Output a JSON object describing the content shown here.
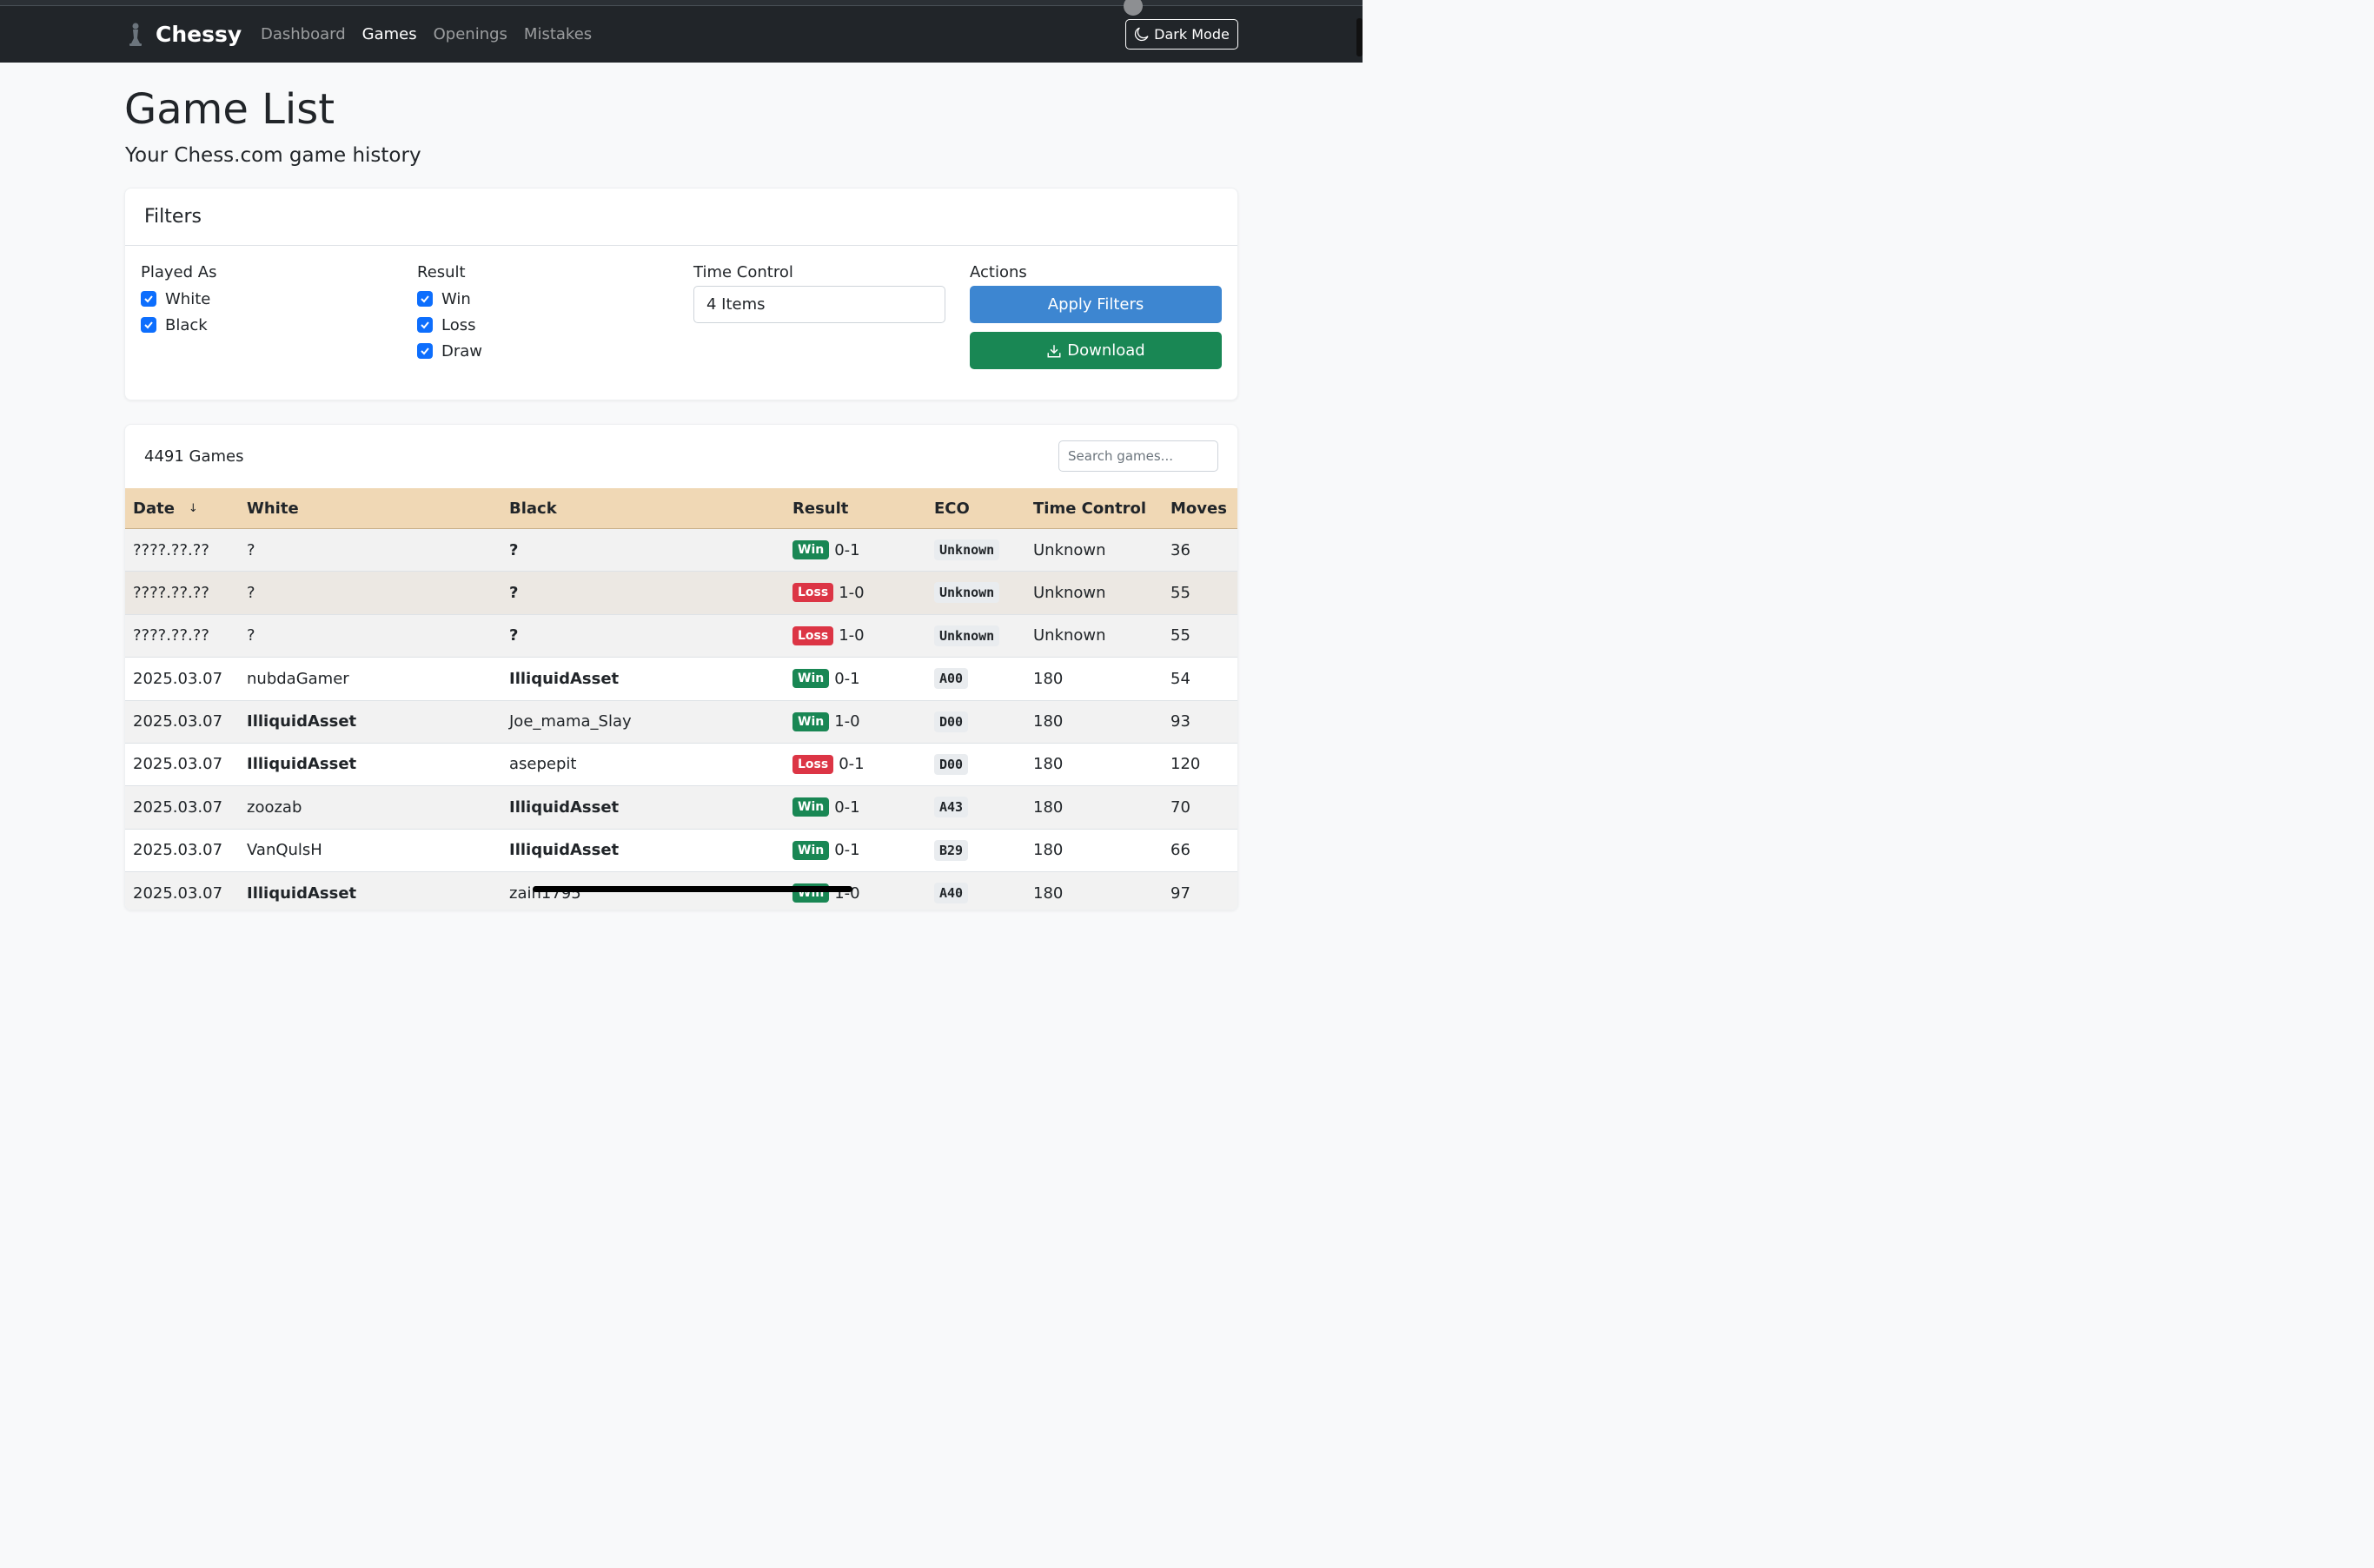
{
  "app": {
    "brand": "Chessy"
  },
  "nav": {
    "links": [
      {
        "label": "Dashboard",
        "active": false
      },
      {
        "label": "Games",
        "active": true
      },
      {
        "label": "Openings",
        "active": false
      },
      {
        "label": "Mistakes",
        "active": false
      }
    ],
    "dark_mode_label": "Dark Mode"
  },
  "header": {
    "title": "Game List",
    "subtitle": "Your Chess.com game history"
  },
  "filters": {
    "title": "Filters",
    "played_as": {
      "label": "Played As",
      "options": [
        {
          "label": "White",
          "checked": true
        },
        {
          "label": "Black",
          "checked": true
        }
      ]
    },
    "result": {
      "label": "Result",
      "options": [
        {
          "label": "Win",
          "checked": true
        },
        {
          "label": "Loss",
          "checked": true
        },
        {
          "label": "Draw",
          "checked": true
        }
      ]
    },
    "time_control": {
      "label": "Time Control",
      "value": "4 Items"
    },
    "actions": {
      "label": "Actions",
      "apply_label": "Apply Filters",
      "download_label": "Download"
    }
  },
  "games": {
    "count_label": "4491 Games",
    "search_placeholder": "Search games...",
    "columns": [
      "Date",
      "White",
      "Black",
      "Result",
      "ECO",
      "Time Control",
      "Moves"
    ],
    "sort_indicator": "↓",
    "rows": [
      {
        "date": "????.??.??",
        "white": "?",
        "black": "?",
        "black_bold": true,
        "white_bold": false,
        "outcome": "Win",
        "score": "0-1",
        "eco": "Unknown",
        "time_control": "Unknown",
        "moves": "36"
      },
      {
        "date": "????.??.??",
        "white": "?",
        "black": "?",
        "black_bold": true,
        "white_bold": false,
        "outcome": "Loss",
        "score": "1-0",
        "eco": "Unknown",
        "time_control": "Unknown",
        "moves": "55"
      },
      {
        "date": "????.??.??",
        "white": "?",
        "black": "?",
        "black_bold": true,
        "white_bold": false,
        "outcome": "Loss",
        "score": "1-0",
        "eco": "Unknown",
        "time_control": "Unknown",
        "moves": "55"
      },
      {
        "date": "2025.03.07",
        "white": "nubdaGamer",
        "black": "IlliquidAsset",
        "black_bold": true,
        "white_bold": false,
        "outcome": "Win",
        "score": "0-1",
        "eco": "A00",
        "time_control": "180",
        "moves": "54"
      },
      {
        "date": "2025.03.07",
        "white": "IlliquidAsset",
        "black": "Joe_mama_Slay",
        "black_bold": false,
        "white_bold": true,
        "outcome": "Win",
        "score": "1-0",
        "eco": "D00",
        "time_control": "180",
        "moves": "93"
      },
      {
        "date": "2025.03.07",
        "white": "IlliquidAsset",
        "black": "asepepit",
        "black_bold": false,
        "white_bold": true,
        "outcome": "Loss",
        "score": "0-1",
        "eco": "D00",
        "time_control": "180",
        "moves": "120"
      },
      {
        "date": "2025.03.07",
        "white": "zoozab",
        "black": "IlliquidAsset",
        "black_bold": true,
        "white_bold": false,
        "outcome": "Win",
        "score": "0-1",
        "eco": "A43",
        "time_control": "180",
        "moves": "70"
      },
      {
        "date": "2025.03.07",
        "white": "VanQulsH",
        "black": "IlliquidAsset",
        "black_bold": true,
        "white_bold": false,
        "outcome": "Win",
        "score": "0-1",
        "eco": "B29",
        "time_control": "180",
        "moves": "66"
      },
      {
        "date": "2025.03.07",
        "white": "IlliquidAsset",
        "black": "zain1795",
        "black_bold": false,
        "white_bold": true,
        "outcome": "Win",
        "score": "1-0",
        "eco": "A40",
        "time_control": "180",
        "moves": "97"
      }
    ]
  },
  "colors": {
    "navbar": "#212529",
    "apply": "#3d86d1",
    "download": "#198754",
    "win": "#198754",
    "loss": "#dc3545",
    "table_header": "#f0d8b5"
  }
}
